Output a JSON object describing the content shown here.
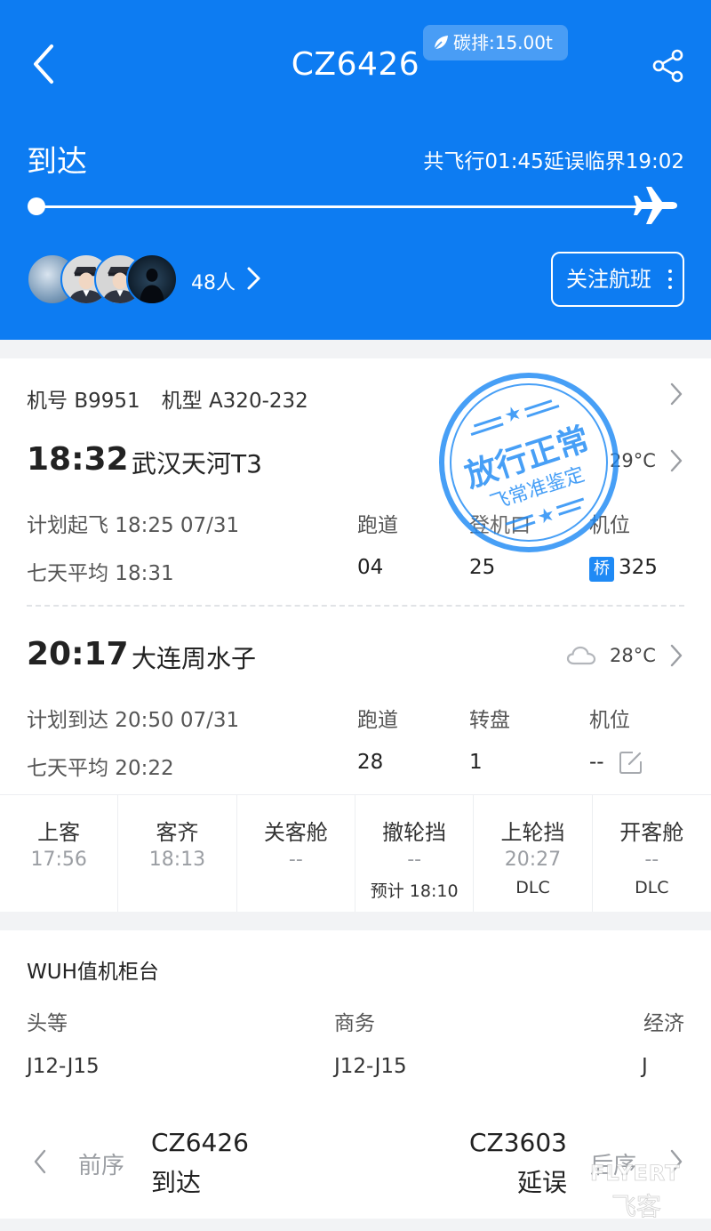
{
  "header": {
    "flight_number": "CZ6426",
    "carbon_label": "碳排:15.00t",
    "status": "到达",
    "flight_summary": "共飞行01:45延误临界19:02",
    "followers": "48人",
    "follow_button": "关注航班"
  },
  "aircraft": {
    "reg_label": "机号",
    "reg_value": "B9951",
    "type_label": "机型",
    "type_value": "A320-232"
  },
  "departure": {
    "actual_time": "18:32",
    "airport": "武汉天河T3",
    "temperature": "29°C",
    "scheduled": "计划起飞 18:25 07/31",
    "avg": "七天平均 18:31",
    "col1_label": "跑道",
    "col2_label": "登机口",
    "col3_label": "机位",
    "runway": "04",
    "gate": "25",
    "bridge_badge": "桥",
    "stand": "325"
  },
  "arrival": {
    "actual_time": "20:17",
    "airport": "大连周水子",
    "temperature": "28°C",
    "weather_icon": "cloud-icon",
    "scheduled": "计划到达 20:50 07/31",
    "avg": "七天平均 20:22",
    "col1_label": "跑道",
    "col2_label": "转盘",
    "col3_label": "机位",
    "runway": "28",
    "carousel": "1",
    "stand": "--"
  },
  "stamp": {
    "main_text": "放行正常",
    "sub_text": "飞常准鉴定"
  },
  "steps": [
    {
      "title": "上客",
      "time": "17:56",
      "note": ""
    },
    {
      "title": "客齐",
      "time": "18:13",
      "note": ""
    },
    {
      "title": "关客舱",
      "time": "--",
      "note": ""
    },
    {
      "title": "撤轮挡",
      "time": "--",
      "note": "预计 18:10"
    },
    {
      "title": "上轮挡",
      "time": "20:27",
      "note": "DLC"
    },
    {
      "title": "开客舱",
      "time": "--",
      "note": "DLC"
    }
  ],
  "checkin": {
    "title": "WUH值机柜台",
    "first_label": "头等",
    "business_label": "商务",
    "economy_label": "经济",
    "first_value": "J12-J15",
    "business_value": "J12-J15",
    "economy_value": "J"
  },
  "sequence": {
    "prev_label": "前序",
    "prev_flight": "CZ6426",
    "prev_status": "到达",
    "next_flight": "CZ3603",
    "next_status": "延误",
    "next_label": "后序"
  },
  "watermark": {
    "text": "FLYERT",
    "logo": "飞客"
  },
  "colors": {
    "header_bg": "#0d7cf2",
    "stamp": "#1f8af5"
  }
}
